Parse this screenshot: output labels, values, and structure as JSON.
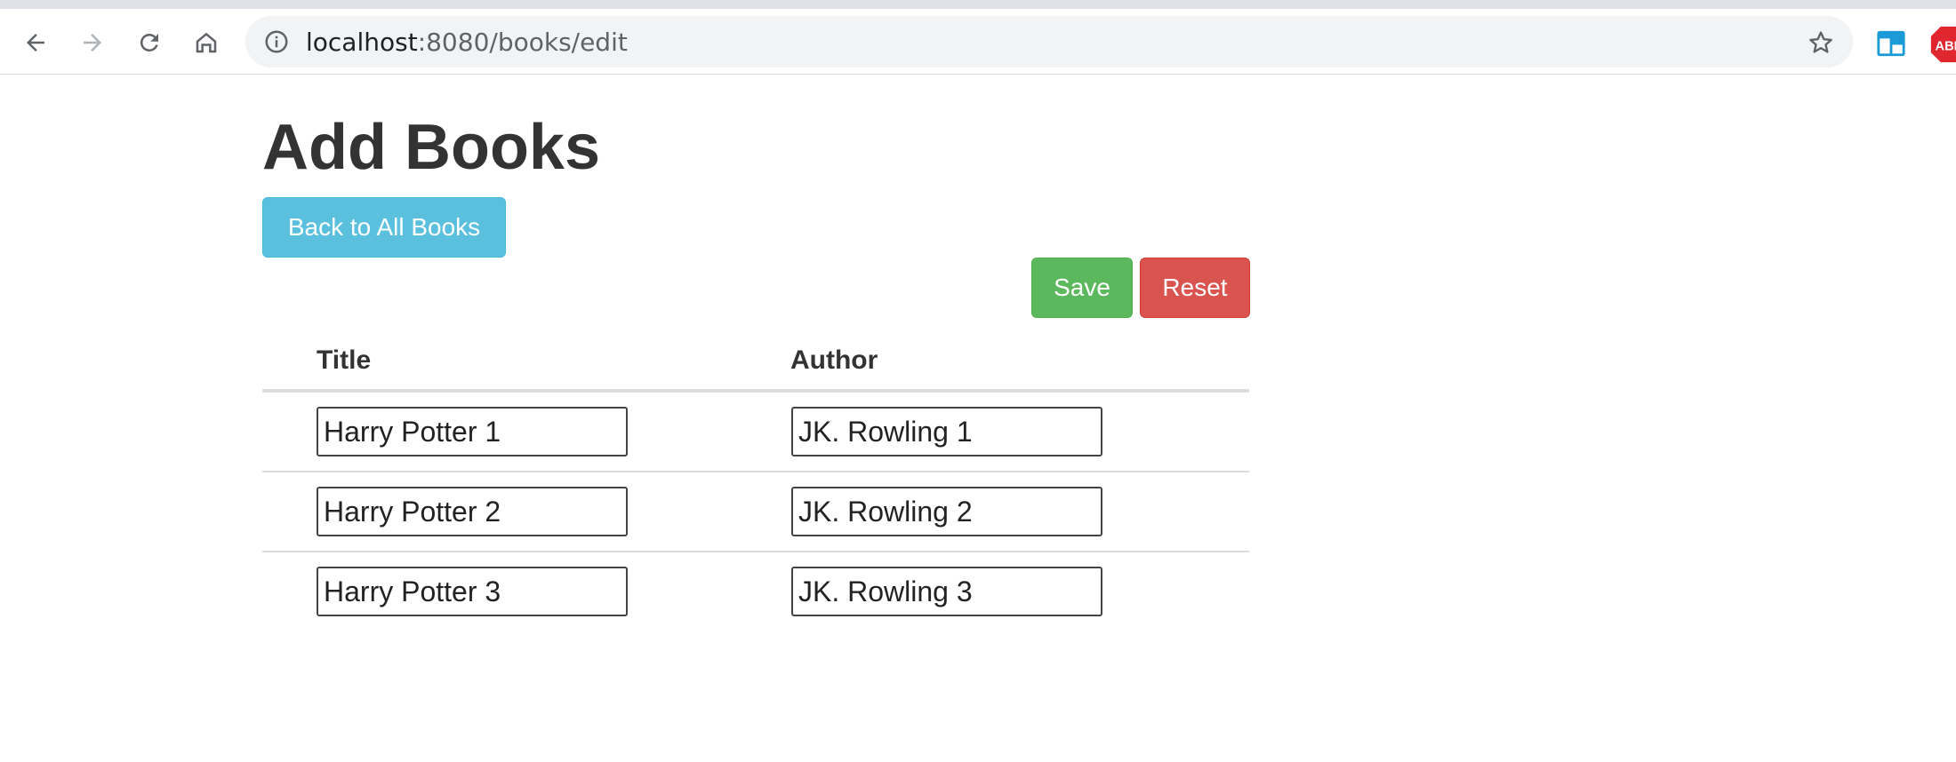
{
  "browser": {
    "url_host": "localhost",
    "url_rest": ":8080/books/edit"
  },
  "page": {
    "title": "Add Books",
    "back_button_label": "Back to All Books",
    "save_label": "Save",
    "reset_label": "Reset"
  },
  "table": {
    "headers": [
      "Title",
      "Author"
    ],
    "rows": [
      {
        "title": "Harry Potter 1",
        "author": "JK. Rowling 1"
      },
      {
        "title": "Harry Potter 2",
        "author": "JK. Rowling 2"
      },
      {
        "title": "Harry Potter 3",
        "author": "JK. Rowling 3"
      }
    ]
  },
  "colors": {
    "info_button": "#5bc0de",
    "success_button": "#5cb85c",
    "danger_button": "#d9534f"
  },
  "icons": [
    "back-arrow-icon",
    "forward-arrow-icon",
    "reload-icon",
    "home-icon",
    "info-icon",
    "star-icon",
    "extension-icon",
    "adblock-icon"
  ]
}
